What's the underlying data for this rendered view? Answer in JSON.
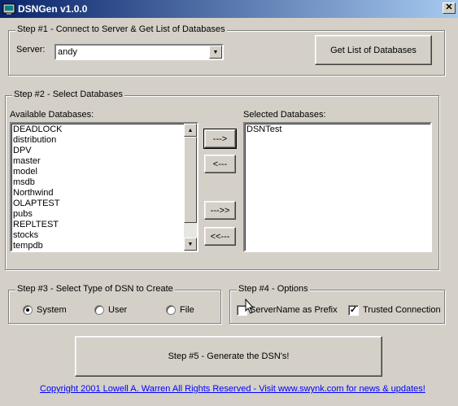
{
  "window": {
    "title": "DSNGen v1.0.0",
    "close_glyph": "✕"
  },
  "step1": {
    "legend": "Step #1 - Connect to Server & Get List of Databases",
    "server_label": "Server:",
    "server_value": "andy",
    "get_list_button": "Get List of Databases"
  },
  "step2": {
    "legend": "Step #2 - Select Databases",
    "available_label": "Available Databases:",
    "selected_label": "Selected Databases:",
    "available": [
      "DEADLOCK",
      "distribution",
      "DPV",
      "master",
      "model",
      "msdb",
      "Northwind",
      "OLAPTEST",
      "pubs",
      "REPLTEST",
      "stocks",
      "tempdb"
    ],
    "selected": [
      "DSNTest"
    ],
    "buttons": {
      "add": "--->",
      "remove": "<---",
      "add_all": "--->>",
      "remove_all": "<<---"
    }
  },
  "step3": {
    "legend": "Step #3 - Select Type of DSN to Create",
    "options": [
      "System",
      "User",
      "File"
    ],
    "selected": "System"
  },
  "step4": {
    "legend": "Step #4 - Options",
    "servername_prefix": {
      "label": "ServerName as Prefix",
      "checked": false
    },
    "trusted_connection": {
      "label": "Trusted Connection",
      "checked": true
    }
  },
  "generate_button": "Step #5 - Generate the DSN's!",
  "footer_link": "Copyright 2001 Lowell A. Warren All Rights Reserved - Visit www.swynk.com for news & updates!",
  "icons": {
    "scroll_up": "▲",
    "scroll_down": "▼",
    "dropdown": "▼",
    "check": "✓"
  }
}
